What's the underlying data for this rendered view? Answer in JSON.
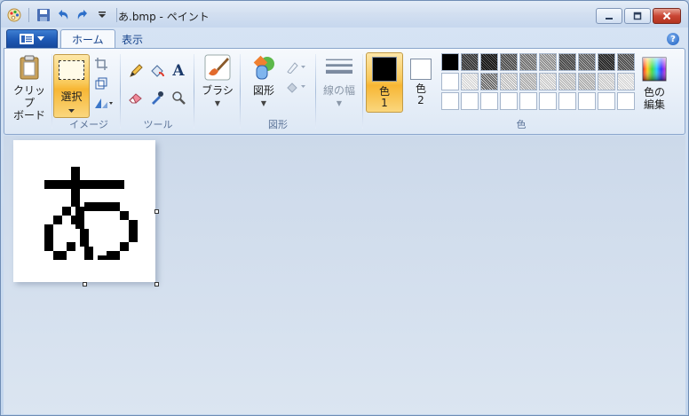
{
  "window": {
    "title": "あ.bmp - ペイント"
  },
  "tabs": [
    {
      "label": "ホーム",
      "active": true
    },
    {
      "label": "表示",
      "active": false
    }
  ],
  "groups": {
    "clipboard": {
      "label": "クリップ\nボード",
      "line1": "クリップ",
      "line2": "ボード"
    },
    "image": {
      "label": "イメージ",
      "select_label": "選択"
    },
    "tools": {
      "label": "ツール"
    },
    "brush": {
      "label": "ブラシ"
    },
    "shapes": {
      "label": "図形",
      "shapes_button": "図形"
    },
    "size": {
      "label": "線の幅"
    },
    "colors": {
      "label": "色",
      "color1_line1": "色",
      "color1_line2": "1",
      "color2_line1": "色",
      "color2_line2": "2",
      "edit_line1": "色の",
      "edit_line2": "編集"
    }
  },
  "colors": {
    "color1": "#000000",
    "color2": "#ffffff",
    "accent": "#f9c95a"
  },
  "canvas": {
    "glyph": "あ"
  }
}
